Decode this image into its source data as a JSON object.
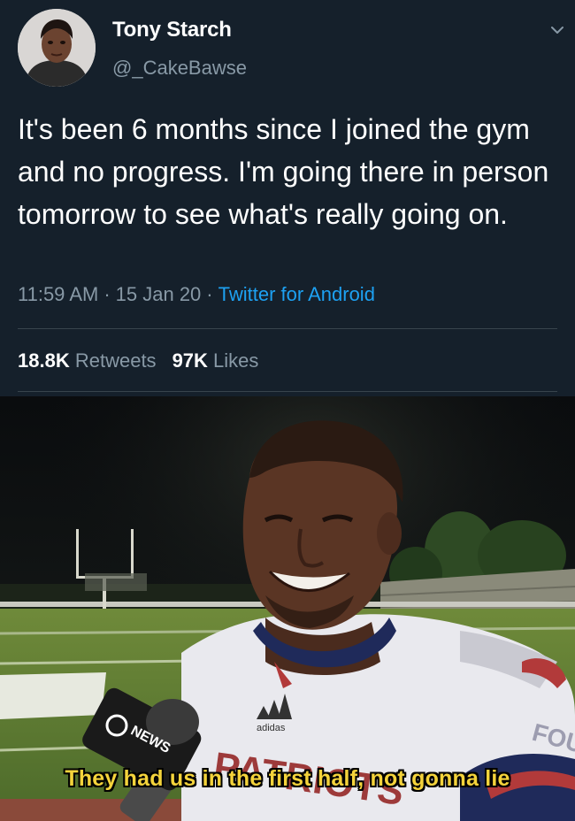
{
  "tweet": {
    "display_name": "Tony Starch",
    "handle": "@_CakeBawse",
    "text": "It's been 6 months since I joined the gym and no progress. I'm going there in person tomorrow to see what's really going on.",
    "time": "11:59 AM",
    "date": "15 Jan 20",
    "source": "Twitter for Android",
    "retweet_count": "18.8K",
    "retweet_label": "Retweets",
    "like_count": "97K",
    "like_label": "Likes",
    "icons": {
      "menu": "chevron-down-icon",
      "avatar": "profile-avatar"
    }
  },
  "meme": {
    "caption": "They had us in the first half, not gonna lie",
    "mic_label": "NEWS",
    "jersey_text": "PATRIOTS",
    "jersey_brand": "adidas"
  },
  "colors": {
    "background": "#15202b",
    "secondary_text": "#8899a6",
    "link": "#1da1f2",
    "divider": "#38444d",
    "caption": "#f4d33b"
  }
}
